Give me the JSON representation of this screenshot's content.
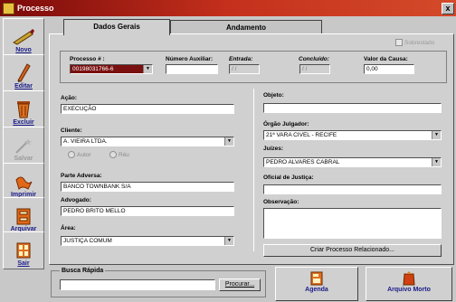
{
  "window": {
    "title": "Processo",
    "close_glyph": "x"
  },
  "toolbar": {
    "items": [
      {
        "label": "Novo",
        "icon": "pen-icon",
        "enabled": true
      },
      {
        "label": "Editar",
        "icon": "pencil-icon",
        "enabled": true
      },
      {
        "label": "Excluir",
        "icon": "trash-icon",
        "enabled": true
      },
      {
        "label": "Salvar",
        "icon": "wand-icon",
        "enabled": false
      },
      {
        "label": "Imprimir",
        "icon": "print-icon",
        "enabled": true
      },
      {
        "label": "Arquivar",
        "icon": "archive-icon",
        "enabled": true
      },
      {
        "label": "Sair",
        "icon": "exit-icon",
        "enabled": true
      }
    ]
  },
  "tabs": [
    {
      "label": "Dados Gerais",
      "active": true
    },
    {
      "label": "Andamento",
      "active": false
    }
  ],
  "form": {
    "sobrestado_label": "Sobrestado",
    "processo": {
      "label": "Processo # :",
      "value": "00198031766-6"
    },
    "numero_auxiliar": {
      "label": "Número Auxiliar:",
      "value": ""
    },
    "entrada": {
      "label": "Entrada:",
      "value": "/ /"
    },
    "concluido": {
      "label": "Concluído:",
      "value": "/ /"
    },
    "valor_causa": {
      "label": "Valor da Causa:",
      "value": "0,00"
    },
    "acao": {
      "label": "Ação:",
      "value": "EXECUÇÃO"
    },
    "cliente": {
      "label": "Cliente:",
      "value": "A. VIEIRA LTDA."
    },
    "radio_autor": "Autor",
    "radio_reu": "Réu",
    "parte_adversa": {
      "label": "Parte Adversa:",
      "value": "BANCO TOWNBANK S/A"
    },
    "advogado": {
      "label": "Advogado:",
      "value": "PEDRO BRITO MELLO"
    },
    "area": {
      "label": "Área:",
      "value": "JUSTIÇA COMUM"
    },
    "objeto": {
      "label": "Objeto:",
      "value": ""
    },
    "orgao": {
      "label": "Órgão Julgador:",
      "value": "21ª VARA CIVEL - RECIFE"
    },
    "juizes": {
      "label": "Juízes:",
      "value": "PEDRO ALVARES CABRAL"
    },
    "oficial": {
      "label": "Oficial de Justiça:",
      "value": ""
    },
    "observacao": {
      "label": "Observação:",
      "value": ""
    },
    "criar_btn": "Criar Processo Relacionado..."
  },
  "bottom": {
    "busca_label": "Busca Rápida",
    "busca_value": "",
    "procurar_btn": "Procurar...",
    "agenda_btn": "Agenda",
    "arquivo_morto_btn": "Arquivo Morto"
  },
  "colors": {
    "title_start": "#7a0a0a",
    "title_end": "#d44a2a",
    "selected_field": "#7a1010",
    "link_blue": "#1a1a8a"
  }
}
